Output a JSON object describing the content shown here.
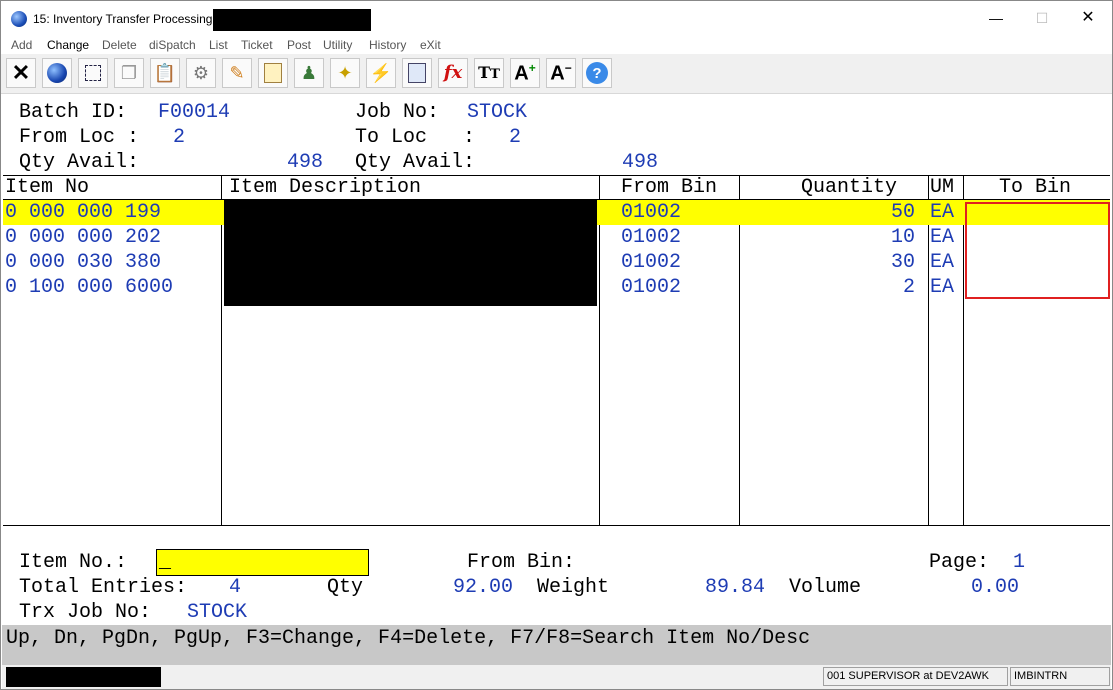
{
  "window": {
    "title": "15: Inventory Transfer Processing -"
  },
  "menu": [
    "Add",
    "Change",
    "Delete",
    "diSpatch",
    "List",
    "Ticket",
    "Post",
    "Utility",
    "History",
    "eXit"
  ],
  "header": {
    "batch_label": "Batch ID:",
    "batch_value": "F00014",
    "job_label": "Job No:",
    "job_value": "STOCK",
    "from_loc_label": "From Loc :",
    "from_loc_value": "2",
    "to_loc_label": "To Loc   :",
    "to_loc_value": "2",
    "qty_avail_label": "Qty Avail:",
    "qty_avail_from": "498",
    "qty_avail_to": "498"
  },
  "grid": {
    "columns": [
      "Item No",
      "Item Description",
      "From Bin",
      "Quantity",
      "UM",
      "To Bin"
    ],
    "rows": [
      {
        "item_no": "0 000 000 199",
        "from_bin": "01002",
        "quantity": "50",
        "um": "EA"
      },
      {
        "item_no": "0 000 000 202",
        "from_bin": "01002",
        "quantity": "10",
        "um": "EA"
      },
      {
        "item_no": "0 000 030 380",
        "from_bin": "01002",
        "quantity": "30",
        "um": "EA"
      },
      {
        "item_no": "0 100 000 6000",
        "from_bin": "01002",
        "quantity": "2",
        "um": "EA"
      }
    ]
  },
  "footer": {
    "item_no_label": "Item No.:",
    "item_no_value": "_",
    "from_bin_label": "From Bin:",
    "page_label": "Page:",
    "page_value": "1",
    "total_entries_label": "Total Entries:",
    "total_entries_value": "4",
    "qty_label": "Qty",
    "qty_value": "92.00",
    "weight_label": "Weight",
    "weight_value": "89.84",
    "volume_label": "Volume",
    "volume_value": "0.00",
    "trx_job_label": "Trx Job No:",
    "trx_job_value": "STOCK"
  },
  "fkeys": "Up, Dn, PgDn, PgUp, F3=Change, F4=Delete, F7/F8=Search Item No/Desc",
  "status": {
    "user": "001 SUPERVISOR at DEV2AWK",
    "program": "IMBINTRN"
  },
  "toolbar_icons": [
    "close-x-icon",
    "globe-icon",
    "select-area-icon",
    "copy-icon",
    "paste-icon",
    "settings-gear-icon",
    "edit-pencil-icon",
    "notepad-icon",
    "users-icon",
    "tag-icon",
    "lightning-icon",
    "calculator-icon",
    "function-fx-icon",
    "text-size-icon",
    "increase-font-icon",
    "decrease-font-icon",
    "help-icon"
  ]
}
